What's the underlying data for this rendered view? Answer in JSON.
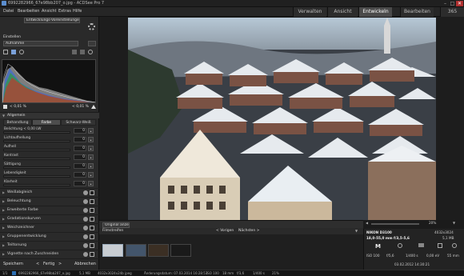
{
  "window": {
    "title": "6992282966_67e98bb207_o.jpg - ACDSee Pro 7",
    "minimize": "–",
    "maximize": "□",
    "close": "✕"
  },
  "menu": [
    "Datei",
    "Bearbeiten",
    "Ansicht",
    "Extras",
    "Hilfe"
  ],
  "modes": {
    "verwalten": "Verwalten",
    "ansicht": "Ansicht",
    "entwickeln": "Entwickeln",
    "bearbeiten": "Bearbeiten",
    "dashboard": "365"
  },
  "left_panel": {
    "preset_dropdown": "Entwicklungs-Voreinstellungen",
    "einstellen_label": "Einstellen",
    "aufnahme_dropdown": "Aufnahme",
    "clip_left": "< 0,01 %",
    "clip_right": "< 0,01 %",
    "allgemein_label": "Allgemein",
    "subtabs": [
      "Behandlung",
      "Farbe",
      "Schwarz-Weiß"
    ],
    "sliders": [
      {
        "label": "Belichtung  < 0,00 LW",
        "value": "0"
      },
      {
        "label": "Lichtaufhellung",
        "value": "0"
      },
      {
        "label": "Aufhell",
        "value": "0"
      },
      {
        "label": "Kontrast",
        "value": "0"
      },
      {
        "label": "Sättigung",
        "value": "0"
      },
      {
        "label": "Lebendigkeit",
        "value": "0"
      },
      {
        "label": "Klarheit",
        "value": "0"
      }
    ],
    "tools": [
      "Weißabgleich",
      "Beleuchtung",
      "Erweiterte Farbe",
      "Gradationskurven",
      "Weichzeichner",
      "Gruppenentwicklung",
      "Teiltonung",
      "Vignette nach Zuschneiden"
    ],
    "buttons": {
      "save": "Speichern",
      "done": "Fertig",
      "cancel": "Abbrechen"
    }
  },
  "filmstrip": {
    "original_label": "Original anzeigen",
    "heading": "Filmstreifen",
    "prev": "< Vorigen",
    "next": "Nächsten >",
    "zoom": "20%"
  },
  "info": {
    "camera": "NIKON D3100",
    "file_size": "4032x3024",
    "lens": "18,0-55,0 mm f/3,5-5,6",
    "size_mb": "5,1 MB",
    "mode": "M",
    "iso": "ISO 100",
    "aperture": "f/5,6",
    "shutter": "1/400 s",
    "ev": "0,00 eV",
    "focal": "55 mm",
    "date": "03.02.2012 14:30:21"
  },
  "status": {
    "index": "1/1",
    "filename": "6992282966_67e98bb207_o.jpg",
    "size": "5,1 MB",
    "dims": "4032x3024x24b jpeg",
    "modified": "Änderungsdatum: 07.03.2014 16:28:53",
    "iso": "ISO 100",
    "focal": "18 mm",
    "aperture": "f/3,6",
    "shutter": "1/400 s",
    "zoom": "21%"
  },
  "colors": {
    "accent": "#4a4a4a",
    "panel": "#2a2a2a",
    "close": "#b03030"
  }
}
